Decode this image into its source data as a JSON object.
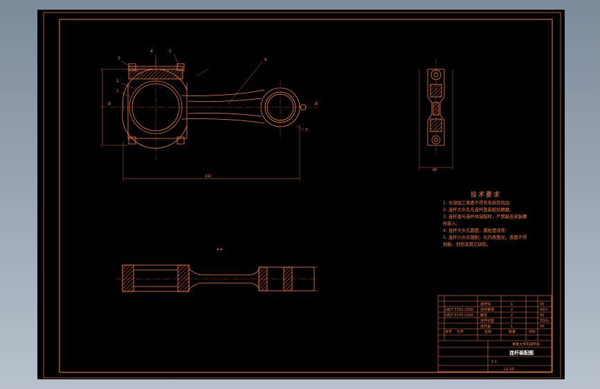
{
  "colors": {
    "background_gradient_top": "#7d8a9a",
    "background_gradient_bottom": "#b9c2cc",
    "sheet": "#000000",
    "line": "#ff8040",
    "centerline": "#c05030",
    "hatch": "#ff6030",
    "text_white": "#ffffff"
  },
  "front_view": {
    "balloons": [
      "3",
      "4",
      "5",
      "2",
      "1",
      "6",
      "7"
    ],
    "section_marks": [
      "B",
      "B"
    ],
    "dim_overall": "192"
  },
  "side_view": {
    "dim_width": "48"
  },
  "section_view": {
    "label": "A-A"
  },
  "tech_notes": {
    "title": "技术要求",
    "lines": [
      "1. 全部加工表面不得有毛刺及锐边;",
      "2. 连杆大头孔与连杆盖装配后精磨;",
      "3. 连杆盖与连杆体装配时，严禁敲击安装螺",
      "   栓装入;",
      "4. 连杆大头孔圆度，圆柱度误差;",
      "5. 连杆小头孔镗削，孔内表面光，表面不得",
      "   划痕、划伤及其它缺陷。"
    ]
  },
  "title_block": {
    "drawing_title": "连杆装配图",
    "scale": "1:1",
    "rows": [
      {
        "code": "GB/T 5782-2000",
        "name": "连杆螺栓",
        "qty": "2",
        "mat": "40Cr"
      },
      {
        "code": "GB/T 6170-2000",
        "name": "螺母",
        "qty": "2",
        "mat": "45"
      },
      {
        "code": "",
        "name": "连杆衬套",
        "qty": "1",
        "mat": "ZQSn"
      },
      {
        "code": "",
        "name": "连杆盖",
        "qty": "1",
        "mat": "45"
      },
      {
        "code": "",
        "name": "连杆体",
        "qty": "1",
        "mat": "45"
      }
    ],
    "headers": [
      "序号",
      "代号",
      "名称",
      "数量",
      "材料"
    ],
    "school": "某某大学机械学院",
    "drawing_number": "LG-00"
  }
}
